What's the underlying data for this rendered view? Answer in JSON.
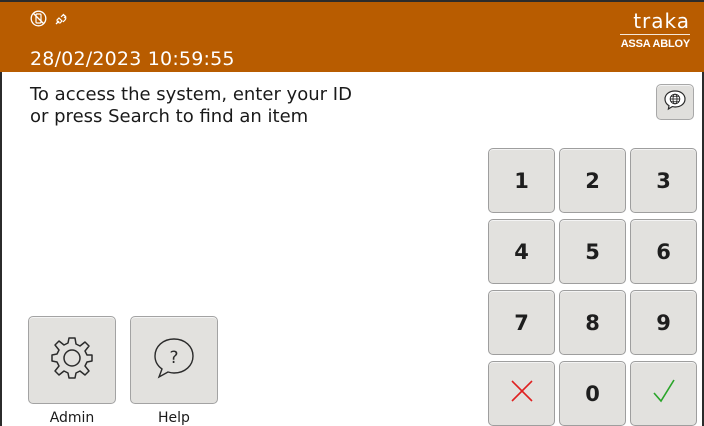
{
  "header": {
    "datetime": "28/02/2023 10:59:55",
    "status_icons": [
      "phone-disabled-icon",
      "plug-disconnected-icon"
    ],
    "logo": {
      "brand": "traka",
      "tagline": "ASSA ABLOY"
    },
    "background_color": "#b85c00"
  },
  "instructions": {
    "line1": "To access the system, enter your ID",
    "line2": "or press Search to find an item"
  },
  "language_button": {
    "icon": "globe-icon"
  },
  "keypad": {
    "keys": [
      {
        "label": "1",
        "name": "key-1"
      },
      {
        "label": "2",
        "name": "key-2"
      },
      {
        "label": "3",
        "name": "key-3"
      },
      {
        "label": "4",
        "name": "key-4"
      },
      {
        "label": "5",
        "name": "key-5"
      },
      {
        "label": "6",
        "name": "key-6"
      },
      {
        "label": "7",
        "name": "key-7"
      },
      {
        "label": "8",
        "name": "key-8"
      },
      {
        "label": "9",
        "name": "key-9"
      },
      {
        "label": "0",
        "name": "key-0"
      }
    ],
    "cancel_icon": "cross-icon",
    "cancel_color": "#e02020",
    "confirm_icon": "check-icon",
    "confirm_color": "#2aa52a"
  },
  "tiles": {
    "admin_label": "Admin",
    "help_label": "Help"
  }
}
